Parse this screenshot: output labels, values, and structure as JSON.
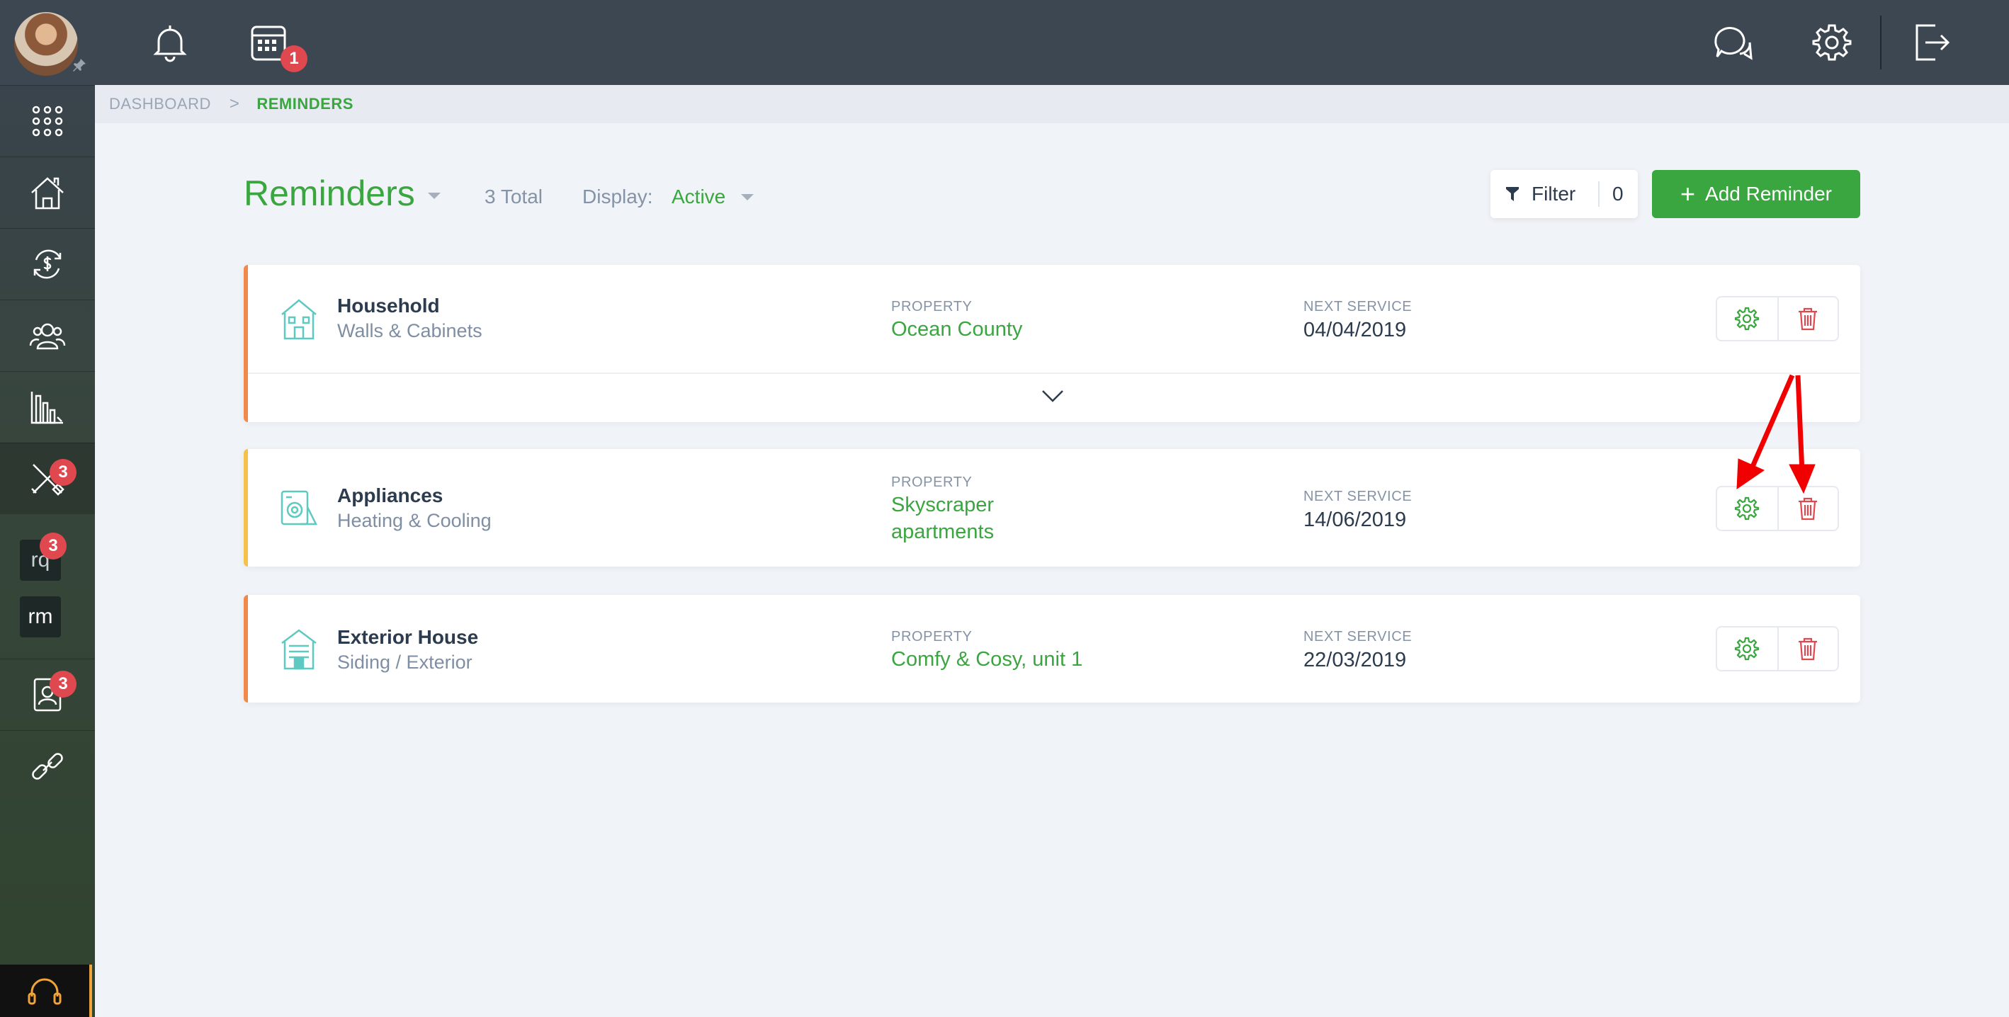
{
  "breadcrumb": {
    "parent": "DASHBOARD",
    "separator": ">",
    "current": "REMINDERS"
  },
  "header": {
    "title": "Reminders",
    "total": "3 Total",
    "display_label": "Display:",
    "display_value": "Active",
    "filter_label": "Filter",
    "filter_count": "0",
    "add_label": "Add Reminder",
    "add_plus": "+"
  },
  "topbar": {
    "calendar_badge": "1"
  },
  "sidebar": {
    "tools_badge": "3",
    "rq_label": "rq",
    "rq_badge": "3",
    "rm_label": "rm",
    "contacts_badge": "3"
  },
  "labels": {
    "property": "PROPERTY",
    "next_service": "NEXT SERVICE"
  },
  "reminders": [
    {
      "category": "Household",
      "subcategory": "Walls & Cabinets",
      "property": "Ocean County",
      "next_service": "04/04/2019",
      "accent": "#f08a4b"
    },
    {
      "category": "Appliances",
      "subcategory": "Heating & Cooling",
      "property_line1": "Skyscraper",
      "property_line2": "apartments",
      "next_service": "14/06/2019",
      "accent": "#f5c14a"
    },
    {
      "category": "Exterior House",
      "subcategory": "Siding / Exterior",
      "property": "Comfy & Cosy, unit 1",
      "next_service": "22/03/2019",
      "accent": "#f08a4b"
    }
  ],
  "colors": {
    "brand_green": "#3aa63f",
    "danger_red": "#e0484f",
    "topbar": "#3d4752",
    "annotation": "#f00000"
  }
}
